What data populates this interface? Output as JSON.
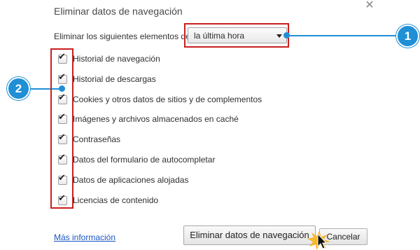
{
  "dialog": {
    "title": "Eliminar datos de navegación",
    "close_icon": "close-icon"
  },
  "period": {
    "label": "Eliminar los siguientes elementos de",
    "selected": "la última hora"
  },
  "items": [
    {
      "label": "Historial de navegación",
      "checked": true
    },
    {
      "label": "Historial de descargas",
      "checked": true
    },
    {
      "label": "Cookies y otros datos de sitios y de complementos",
      "checked": true
    },
    {
      "label": "Imágenes y archivos almacenados en caché",
      "checked": true
    },
    {
      "label": "Contraseñas",
      "checked": true
    },
    {
      "label": "Datos del formulario de autocompletar",
      "checked": true
    },
    {
      "label": "Datos de aplicaciones alojadas",
      "checked": true
    },
    {
      "label": "Licencias de contenido",
      "checked": true
    }
  ],
  "footer": {
    "more_info": "Más información",
    "clear_button": "Eliminar datos de navegación",
    "cancel_button": "Cancelar"
  },
  "callouts": [
    {
      "number": "1"
    },
    {
      "number": "2"
    }
  ],
  "colors": {
    "highlight": "#c8201e",
    "callout": "#1f8fd6",
    "link": "#1a56c4"
  }
}
